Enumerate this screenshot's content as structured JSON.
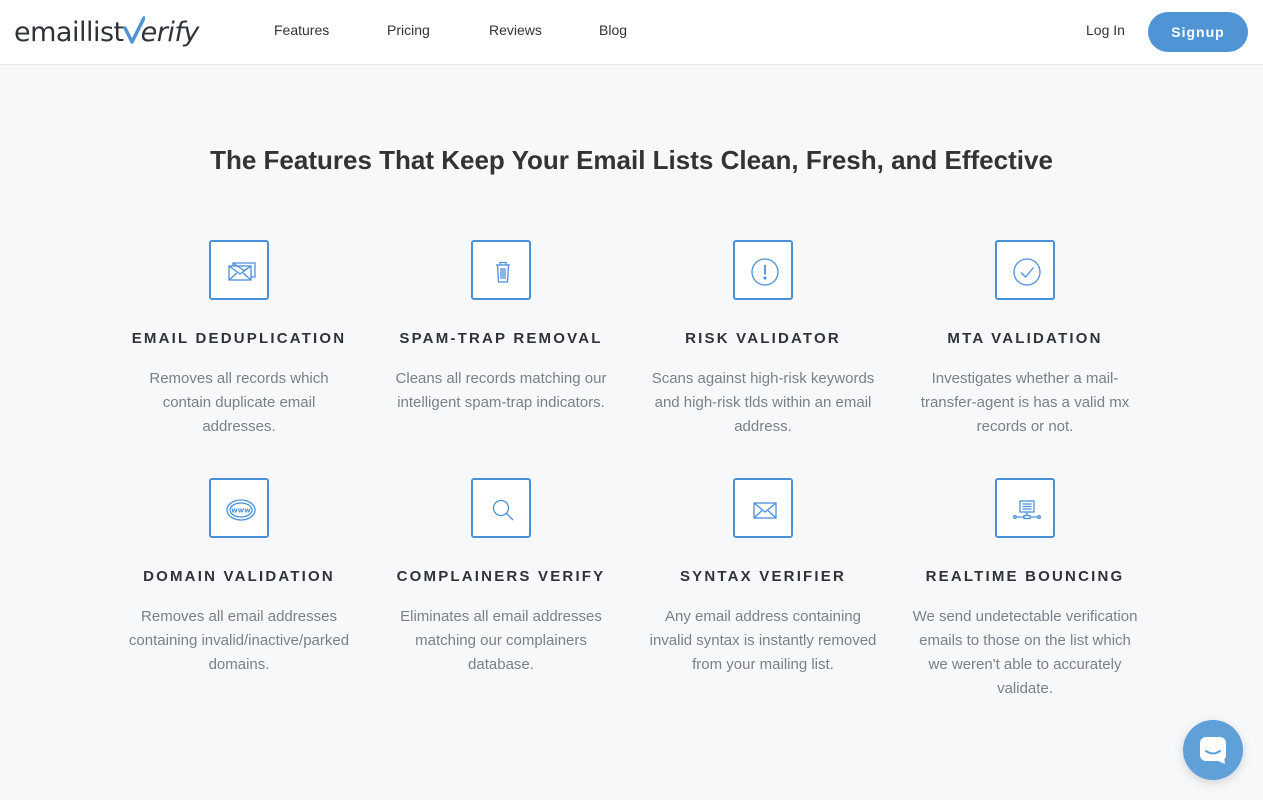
{
  "brand": {
    "logo_left": "emaillist",
    "logo_right": "erify",
    "accent": "#4f95d6"
  },
  "nav": {
    "items": [
      {
        "label": "Features"
      },
      {
        "label": "Pricing"
      },
      {
        "label": "Reviews"
      },
      {
        "label": "Blog"
      }
    ],
    "login": "Log In",
    "signup": "Signup"
  },
  "section": {
    "heading": "The Features That Keep Your Email Lists Clean, Fresh, and Effective"
  },
  "features": [
    {
      "icon": "envelopes-icon",
      "title": "EMAIL DEDUPLICATION",
      "desc": "Removes all records which contain duplicate email addresses."
    },
    {
      "icon": "trash-icon",
      "title": "SPAM-TRAP REMOVAL",
      "desc": "Cleans all records matching our intelligent spam-trap indicators."
    },
    {
      "icon": "exclamation-circle-icon",
      "title": "RISK VALIDATOR",
      "desc": "Scans against high-risk keywords and high-risk tlds within an email address."
    },
    {
      "icon": "check-circle-icon",
      "title": "MTA VALIDATION",
      "desc": "Investigates whether a mail-transfer-agent is has a valid mx records or not."
    },
    {
      "icon": "www-icon",
      "title": "DOMAIN VALIDATION",
      "desc": "Removes all email addresses containing invalid/inactive/parked domains."
    },
    {
      "icon": "magnifier-icon",
      "title": "COMPLAINERS VERIFY",
      "desc": "Eliminates all email addresses matching our complainers database."
    },
    {
      "icon": "envelope-icon",
      "title": "SYNTAX VERIFIER",
      "desc": "Any email address containing invalid syntax is instantly removed from your mailing list."
    },
    {
      "icon": "server-network-icon",
      "title": "REALTIME BOUNCING",
      "desc": "We send undetectable verification emails to those on the list which we weren't able to accurately validate."
    }
  ],
  "chat": {
    "icon": "chat-bubble-icon"
  }
}
